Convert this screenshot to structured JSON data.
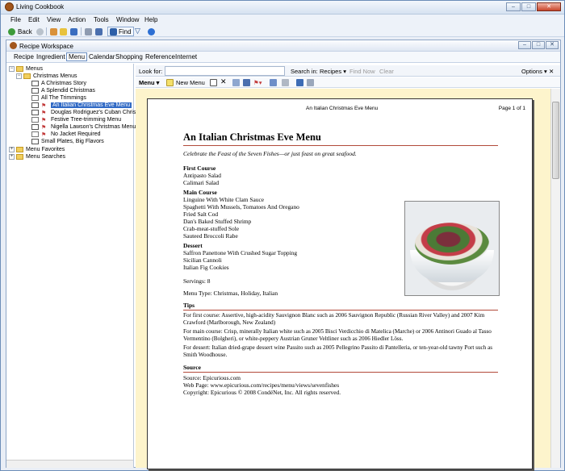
{
  "app": {
    "title": "Living Cookbook"
  },
  "window_buttons": {
    "minimize": "–",
    "maximize": "□",
    "close": "✕"
  },
  "menubar": {
    "items": [
      "File",
      "Edit",
      "View",
      "Action",
      "Tools",
      "Window",
      "Help"
    ]
  },
  "toolbar": {
    "back": "Back",
    "find": "Find"
  },
  "workspace": {
    "title": "Recipe Workspace",
    "tabs": [
      "Recipe",
      "Ingredient",
      "Menu",
      "Calendar",
      "Shopping",
      "Reference",
      "Internet"
    ],
    "active_tab": "Menu"
  },
  "tree": {
    "menus": "Menus",
    "christmas_menus": "Christmas Menus",
    "items": [
      "A Christmas Story",
      "A Splendid Christmas",
      "All The Trimmings",
      "An Italian Christmas Eve Menu",
      "Douglas Rodriguez's Cuban Christ",
      "Festive Tree-trimming Menu",
      "Nigella Lawson's Christmas Menu",
      "No Jacket Required",
      "Small Plates, Big Flavors"
    ],
    "selected": "An Italian Christmas Eve Menu",
    "menu_favorites": "Menu Favorites",
    "menu_searches": "Menu Searches"
  },
  "search": {
    "look_for_label": "Look for:",
    "search_in_label": "Search in:",
    "search_in_value": "Recipes",
    "find_now": "Find Now",
    "clear": "Clear",
    "options": "Options"
  },
  "menu_toolbar": {
    "menu": "Menu",
    "new_menu": "New Menu"
  },
  "page_header": {
    "title": "An Italian Christmas Eve Menu",
    "page": "Page 1 of 1"
  },
  "recipe": {
    "title": "An Italian Christmas Eve Menu",
    "subtitle": "Celebrate the Feast of the Seven Fishes—or just feast on great seafood.",
    "courses": [
      {
        "name": "First Course",
        "items": [
          "Antipasto Salad",
          "Calimari Salad"
        ]
      },
      {
        "name": "Main Course",
        "items": [
          "Linguine With White Clam Sauce",
          "Spaghetti With Mussels, Tomatoes And Oregano",
          "Fried Salt Cod",
          "Dan's Baked Stuffed Shrimp",
          "Crab-meat-stuffed Sole",
          "Sauteed Broccoli Rabe"
        ]
      },
      {
        "name": "Dessert",
        "items": [
          "Saffron Panettone With Crushed Sugar Topping",
          "Sicilian Cannoli",
          "Italian Fig Cookies"
        ]
      }
    ],
    "servings": "Servings: 8",
    "menu_type": "Menu Type: Christmas, Holiday, Italian",
    "tips_heading": "Tips",
    "tips": [
      "For first course: Assertive, high-acidity Sauvignon Blanc such as 2006 Sauvignon Republic (Russian River Valley) and 2007 Kim Crawford (Marlborough, New Zealand)",
      "For main course: Crisp, minerally Italian white such as 2005 Bisci Verdicchio di Matelica (Marche) or 2006 Antinori Guado al Tasso Vermentino (Bolgheri), or white-peppery Austrian Gruner Veltliner such as 2006 Hiedler Löss.",
      "For dessert: Italian dried-grape dessert wine Passito such as 2005 Pellegrino Passito di Pantelleria, or ten-year-old tawny Port such as Smith Woodhouse."
    ],
    "source_heading": "Source",
    "source": "Source: Epicurious.com",
    "web_page": "Web Page: www.epicurious.com/recipes/menu/views/sevenfishes",
    "copyright": "Copyright: Epicurious © 2008 CondéNet, Inc. All rights reserved."
  },
  "colors": {
    "accent": "#316ac5",
    "rule": "#b24a3a",
    "viewer_bg": "#fdf4cc"
  }
}
